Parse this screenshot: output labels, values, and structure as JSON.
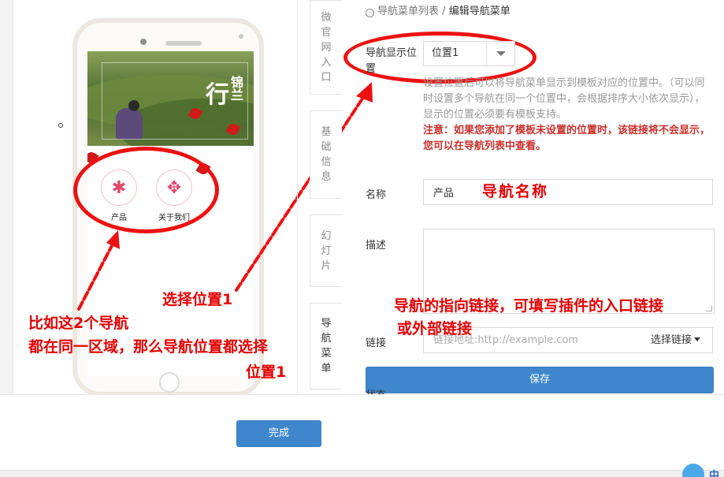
{
  "breadcrumb": {
    "back_icon": "circle-left-arrow-icon",
    "parent": "导航菜单列表",
    "separator": "/",
    "current": "编辑导航菜单"
  },
  "vertical_tabs": [
    {
      "label": "微官网入口"
    },
    {
      "label": "基础信息"
    },
    {
      "label": "幻灯片"
    },
    {
      "label": "导航菜单"
    }
  ],
  "phone_preview": {
    "banner_title": "行",
    "banner_title_side": "锦兰",
    "nav_items": [
      {
        "label": "产品",
        "icon": "bug-icon"
      },
      {
        "label": "关于我们",
        "icon": "move-arrows-icon"
      }
    ]
  },
  "form": {
    "position": {
      "label": "导航显示位置",
      "value": "位置1"
    },
    "help_text": "设置位置后可以将导航菜单显示到模板对应的位置中。（可以同时设置多个导航在同一个位置中，会根据排序大小依次显示），显示的位置必须要有模板支持。",
    "warning_text": "注意：如果您添加了模板未设置的位置时，该链接将不会显示，您可以在导航列表中查看。",
    "name": {
      "label": "名称",
      "value": "产品"
    },
    "description": {
      "label": "描述",
      "value": ""
    },
    "link": {
      "label": "链接",
      "value": "",
      "placeholder": "链接地址:http://example.com",
      "select_label": "选择链接"
    },
    "save_label": "保存",
    "cut_label": "状态"
  },
  "done_label": "完成",
  "annotations": {
    "select_position": "选择位置1",
    "nav_name": "导航名称",
    "link_hint_line1": "导航的指向链接，可填写插件的入口链接",
    "link_hint_line2": "或外部链接",
    "example_line1": "比如这2个导航",
    "example_line2": "都在同一区域，那么导航位置都选择",
    "example_line3": "位置1"
  },
  "ime_label": "中",
  "colors": {
    "annotation_red": "#ee1111",
    "primary_blue": "#3f87cc",
    "warning_red": "#c9302c"
  }
}
